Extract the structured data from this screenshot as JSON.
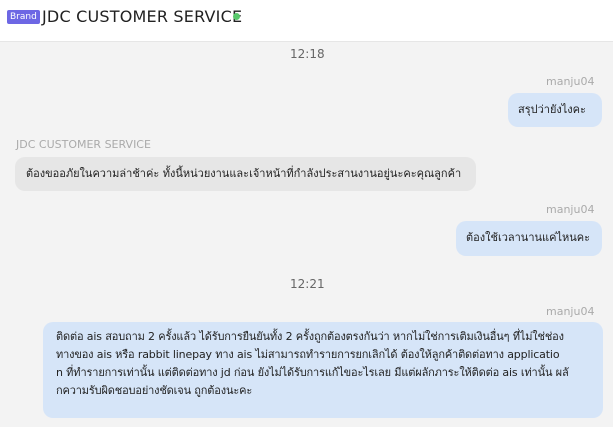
{
  "header": {
    "badge": "Brand",
    "title": "JDC CUSTOMER SERVICE",
    "status_color": "#58c86b"
  },
  "messages": [
    {
      "type": "timestamp",
      "text": "12:18"
    },
    {
      "type": "outgoing",
      "sender": "manju04",
      "text": "สรุปว่ายังไงคะ"
    },
    {
      "type": "incoming",
      "sender": "JDC CUSTOMER SERVICE",
      "text": "ต้องขออภัยในความล่าช้าค่ะ ทั้งนี้หน่วยงานและเจ้าหน้าที่กำลังประสานงานอยู่นะคะคุณลูกค้า"
    },
    {
      "type": "outgoing",
      "sender": "manju04",
      "text": "ต้องใช้เวลานานแค่ไหนคะ"
    },
    {
      "type": "timestamp",
      "text": "12:21"
    },
    {
      "type": "outgoing",
      "sender": "manju04",
      "lines": [
        "ติดต่อ ais สอบถาม 2 ครั้งแล้ว ได้รับการยืนยันทั้ง 2 ครั้งถูกต้องตรงกันว่า หากไม่ใช่การเติมเงินอื่นๆ ที่ไม่ใช่ช่อง",
        "ทางของ ais หรือ rabbit linepay ทาง ais ไม่สามารถทำรายการยกเลิกได้ ต้องให้ลูกค้าติดต่อทาง applicatio",
        "n ที่ทำรายการเท่านั้น แต่ติดต่อทาง jd ก่อน ยังไม่ได้รับการแก้ไขอะไรเลย มีแต่ผลักภาระให้ติดต่อ ais เท่านั้น ผลั",
        "กความรับผิดชอบอย่างชัดเจน ถูกต้องนะคะ"
      ]
    }
  ]
}
